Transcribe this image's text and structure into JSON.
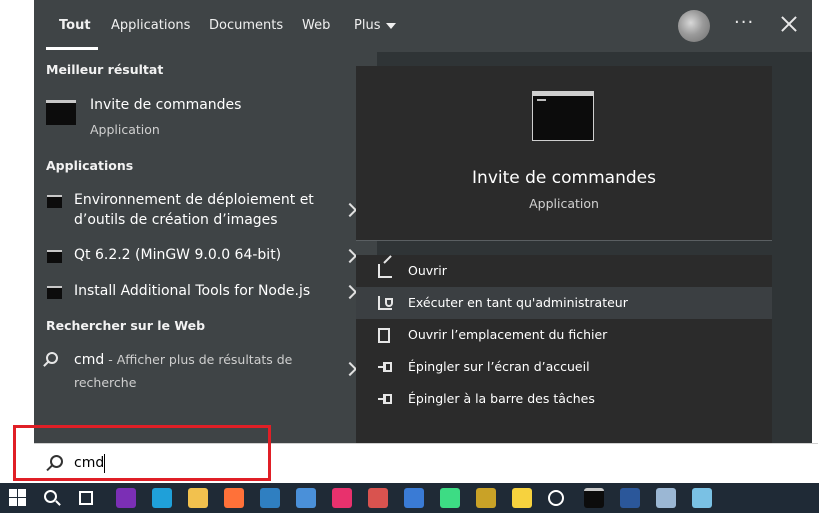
{
  "tabs": [
    {
      "label": "Tout",
      "active": true
    },
    {
      "label": "Applications"
    },
    {
      "label": "Documents"
    },
    {
      "label": "Web"
    },
    {
      "label": "Plus"
    }
  ],
  "header": {
    "more_label": "···"
  },
  "best_match": {
    "heading": "Meilleur résultat",
    "title": "Invite de commandes",
    "subtitle": "Application"
  },
  "apps": {
    "heading": "Applications",
    "items": [
      {
        "label": "Environnement de déploiement et d’outils de création d’images"
      },
      {
        "label": "Qt 6.2.2 (MinGW 9.0.0 64-bit)"
      },
      {
        "label": "Install Additional Tools for Node.js"
      }
    ]
  },
  "web": {
    "heading": "Rechercher sur le Web",
    "query": "cmd",
    "rest": " - Afficher plus de résultats de recherche"
  },
  "preview": {
    "title": "Invite de commandes",
    "subtitle": "Application"
  },
  "actions": [
    {
      "label": "Ouvrir",
      "icon": "open-icon"
    },
    {
      "label": "Exécuter en tant qu'administrateur",
      "icon": "admin-shield-icon"
    },
    {
      "label": "Ouvrir l’emplacement du fichier",
      "icon": "file-location-icon"
    },
    {
      "label": "Épingler sur l’écran d’accueil",
      "icon": "pin-icon"
    },
    {
      "label": "Épingler à la barre des tâches",
      "icon": "pin-icon"
    }
  ],
  "search": {
    "value": "cmd"
  },
  "colors": {
    "highlight": "#e01f26",
    "taskbar": "#1f2a36",
    "panel": "#3f4446"
  },
  "taskbar": {
    "items": [
      {
        "name": "onenote-icon",
        "color": "#7b2fb5"
      },
      {
        "name": "edge-icon",
        "color": "#1fa0d9"
      },
      {
        "name": "file-explorer-icon",
        "color": "#f2c14e"
      },
      {
        "name": "firefox-icon",
        "color": "#ff7139"
      },
      {
        "name": "virtualbox-icon",
        "color": "#2f7fc1"
      },
      {
        "name": "network-tool-icon",
        "color": "#4a90d9"
      },
      {
        "name": "jetbrains-icon",
        "color": "#e8316d"
      },
      {
        "name": "paint-icon",
        "color": "#d9534f"
      },
      {
        "name": "letter-a-icon",
        "color": "#3a7bd5"
      },
      {
        "name": "android-icon",
        "color": "#3ddc84"
      },
      {
        "name": "puzzle-icon",
        "color": "#c9a227"
      },
      {
        "name": "sticky-notes-icon",
        "color": "#f7d23e"
      },
      {
        "name": "settings-icon",
        "color": "#ffffff"
      },
      {
        "name": "terminal-icon",
        "color": "#0c0c0c"
      },
      {
        "name": "word-icon",
        "color": "#2b579a"
      },
      {
        "name": "app-icon",
        "color": "#9bb7d4"
      },
      {
        "name": "notes-icon",
        "color": "#7ac1e4"
      }
    ]
  }
}
